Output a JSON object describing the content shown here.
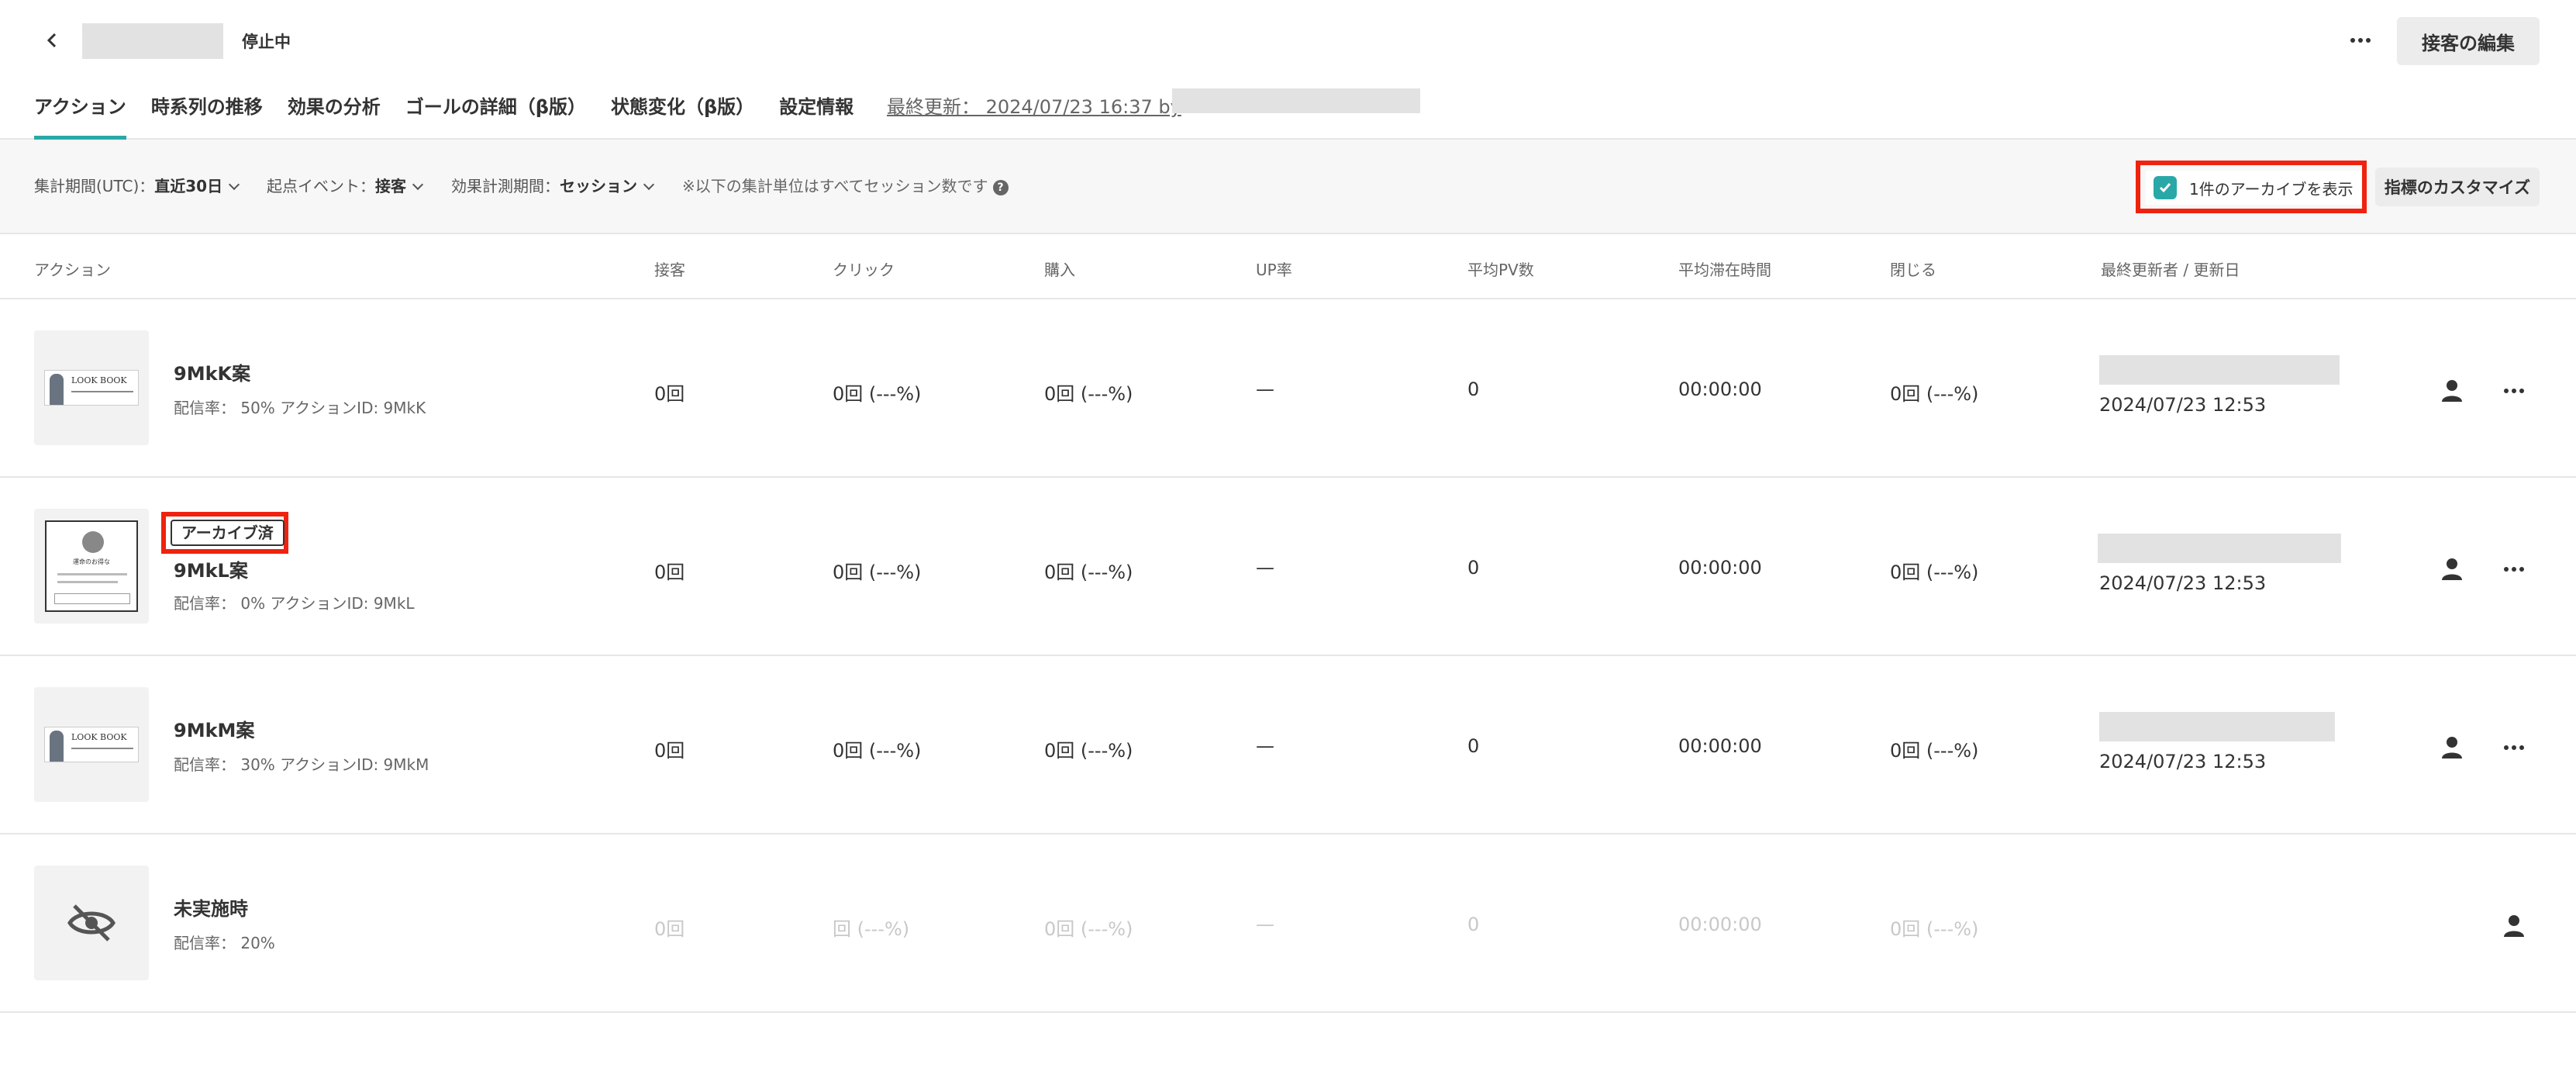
{
  "header": {
    "status": "停止中",
    "edit_label": "接客の編集",
    "updated_text": "最終更新： 2024/07/23 16:37 by"
  },
  "tabs": [
    {
      "label": "アクション",
      "active": true
    },
    {
      "label": "時系列の推移"
    },
    {
      "label": "効果の分析"
    },
    {
      "label": "ゴールの詳細（β版）"
    },
    {
      "label": "状態変化（β版）"
    },
    {
      "label": "設定情報"
    }
  ],
  "filters": {
    "period_label": "集計期間(UTC)：",
    "period_value": "直近30日",
    "event_label": "起点イベント：",
    "event_value": "接客",
    "measure_label": "効果計測期間：",
    "measure_value": "セッション",
    "note": "※以下の集計単位はすべてセッション数です",
    "archive_toggle": "1件のアーカイブを表示",
    "archive_checked": true,
    "customize_label": "指標のカスタマイズ"
  },
  "columns": [
    "アクション",
    "接客",
    "クリック",
    "購入",
    "UP率",
    "平均PV数",
    "平均滞在時間",
    "閉じる",
    "最終更新者 / 更新日"
  ],
  "rows": [
    {
      "name": "9MkK案",
      "sub": "配信率： 50% アクションID: 9MkK",
      "banner_text": "LOOK BOOK",
      "serve": "0回",
      "click": "0回 (---%)",
      "purchase": "0回 (---%)",
      "up": "—",
      "pv": "0",
      "stay": "00:00:00",
      "close": "0回 (---%)",
      "updated": "2024/07/23 12:53"
    },
    {
      "name": "9MkL案",
      "sub": "配信率： 0% アクションID: 9MkL",
      "badge": "アーカイブ済",
      "popup_title": "運命のお得な",
      "serve": "0回",
      "click": "0回 (---%)",
      "purchase": "0回 (---%)",
      "up": "—",
      "pv": "0",
      "stay": "00:00:00",
      "close": "0回 (---%)",
      "updated": "2024/07/23 12:53"
    },
    {
      "name": "9MkM案",
      "sub": "配信率： 30% アクションID: 9MkM",
      "banner_text": "LOOK BOOK",
      "serve": "0回",
      "click": "0回 (---%)",
      "purchase": "0回 (---%)",
      "up": "—",
      "pv": "0",
      "stay": "00:00:00",
      "close": "0回 (---%)",
      "updated": "2024/07/23 12:53"
    },
    {
      "name": "未実施時",
      "sub": "配信率： 20%",
      "serve": "0回",
      "click": "回 (---%)",
      "purchase": "0回 (---%)",
      "up": "—",
      "pv": "0",
      "stay": "00:00:00",
      "close": "0回 (---%)"
    }
  ],
  "icons": {
    "back": "chevron-left-icon",
    "more": "more-horizontal-icon",
    "check": "check-icon",
    "help": "question-circle-icon",
    "person": "person-icon",
    "hidden": "eye-off-icon"
  },
  "colors": {
    "accent": "#2aa8a8",
    "highlight": "#f0220f"
  }
}
